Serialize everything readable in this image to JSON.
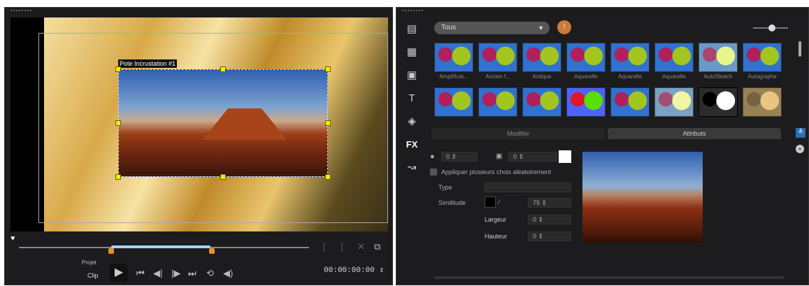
{
  "preview": {
    "clip_label": "Pote Incrustation #1"
  },
  "player": {
    "project_label": "Projet",
    "clip_label": "Clip",
    "timecode": "00:00:00:00"
  },
  "library": {
    "category": "Tous",
    "row1": [
      "Amplificat...",
      "Ancien f...",
      "Antique",
      "Aquarelle",
      "Aquarelle",
      "Aquarelle",
      "AutoSketch",
      "Autographe"
    ],
    "row2": [
      "",
      "",
      "",
      "",
      "",
      "",
      "",
      ""
    ],
    "tabs": {
      "modify": "Modifier",
      "attributes": "Attributs"
    }
  },
  "attributes": {
    "mask_value": "0",
    "border_value": "0",
    "apply_checkbox": "Appliquer plusieurs choix aléatoirement",
    "type_label": "Type",
    "similarity_label": "Similitude",
    "similarity_value": "75",
    "width_label": "Largeur",
    "width_value": "0",
    "height_label": "Hauteur",
    "height_value": "0"
  },
  "icons": [
    "media",
    "instant-project",
    "transition",
    "title",
    "graphic",
    "fx",
    "path"
  ]
}
